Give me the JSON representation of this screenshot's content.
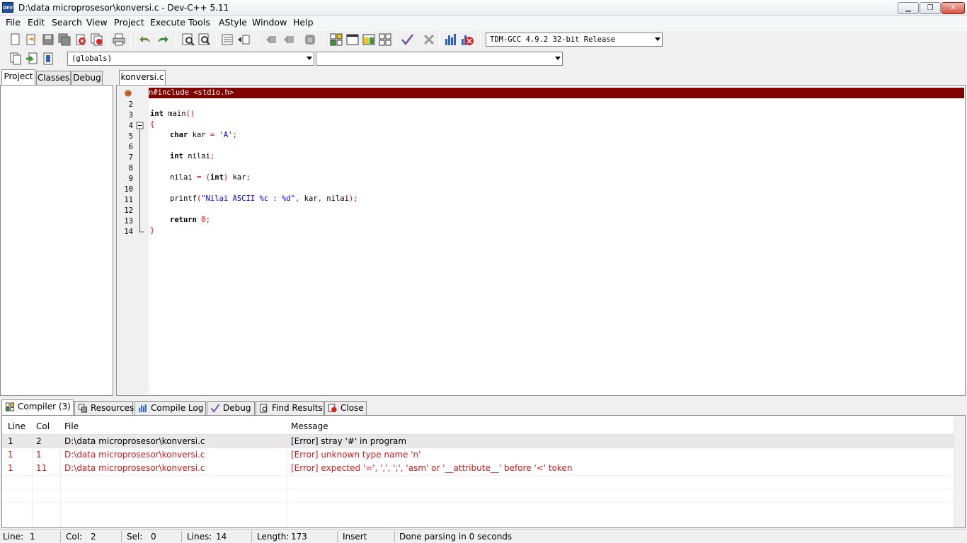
{
  "window": {
    "app_icon_text": "DEV",
    "title": "D:\\data microprosesor\\konversi.c - Dev-C++ 5.11",
    "min_glyph": "▁",
    "max_glyph": "❐",
    "close_glyph": "✕"
  },
  "menu": [
    "File",
    "Edit",
    "Search",
    "View",
    "Project",
    "Execute",
    "Tools",
    "AStyle",
    "Window",
    "Help"
  ],
  "toolbar": {
    "compiler_select": "TDM-GCC 4.9.2 32-bit Release",
    "scope_select": "(globals)",
    "function_select": ""
  },
  "left_panel": {
    "tabs": [
      "Project",
      "Classes",
      "Debug"
    ]
  },
  "editor": {
    "file_tab": "konversi.c",
    "line_numbers": [
      "2",
      "3",
      "4",
      "5",
      "6",
      "7",
      "8",
      "9",
      "10",
      "11",
      "12",
      "13",
      "14"
    ],
    "error_line": "n#include <stdio.h>",
    "code": {
      "l3_kw": "int",
      "l3_rest": " main",
      "l3_paren": "()",
      "l4": "{",
      "l5_kw": "char",
      "l5_a": " kar ",
      "l5_eq": "=",
      "l5_str": " 'A'",
      "l5_semi": ";",
      "l7_kw": "int",
      "l7_a": " nilai",
      "l7_semi": ";",
      "l9_a": "nilai ",
      "l9_eq": "=",
      "l9_p1": " (",
      "l9_kw": "int",
      "l9_p2": ")",
      "l9_b": " kar",
      "l9_semi": ";",
      "l11_a": "printf",
      "l11_p1": "(",
      "l11_str": "\"Nilai ASCII %c : %d\"",
      "l11_c1": ",",
      "l11_b": " kar",
      "l11_c2": ",",
      "l11_c": " nilai",
      "l11_p2": ")",
      "l11_semi": ";",
      "l13_kw": "return",
      "l13_num": " 0",
      "l13_semi": ";",
      "l14": "}"
    }
  },
  "bottom_tabs": [
    "Compiler (3)",
    "Resources",
    "Compile Log",
    "Debug",
    "Find Results",
    "Close"
  ],
  "compiler": {
    "headers": {
      "line": "Line",
      "col": "Col",
      "file": "File",
      "message": "Message"
    },
    "rows": [
      {
        "line": "1",
        "col": "2",
        "file": "D:\\data microprosesor\\konversi.c",
        "message": "[Error] stray '#' in program"
      },
      {
        "line": "1",
        "col": "1",
        "file": "D:\\data microprosesor\\konversi.c",
        "message": "[Error] unknown type name 'n'"
      },
      {
        "line": "1",
        "col": "11",
        "file": "D:\\data microprosesor\\konversi.c",
        "message": "[Error] expected '=', ',', ';', 'asm' or '__attribute__' before '<' token"
      }
    ],
    "error_color": "#d11a1a"
  },
  "status": {
    "line_label": "Line:",
    "line_value": "1",
    "col_label": "Col:",
    "col_value": "2",
    "sel_label": "Sel:",
    "sel_value": "0",
    "lines_label": "Lines:",
    "lines_value": "14",
    "length_label": "Length:",
    "length_value": "173",
    "mode": "Insert",
    "message": "Done parsing in 0 seconds"
  }
}
